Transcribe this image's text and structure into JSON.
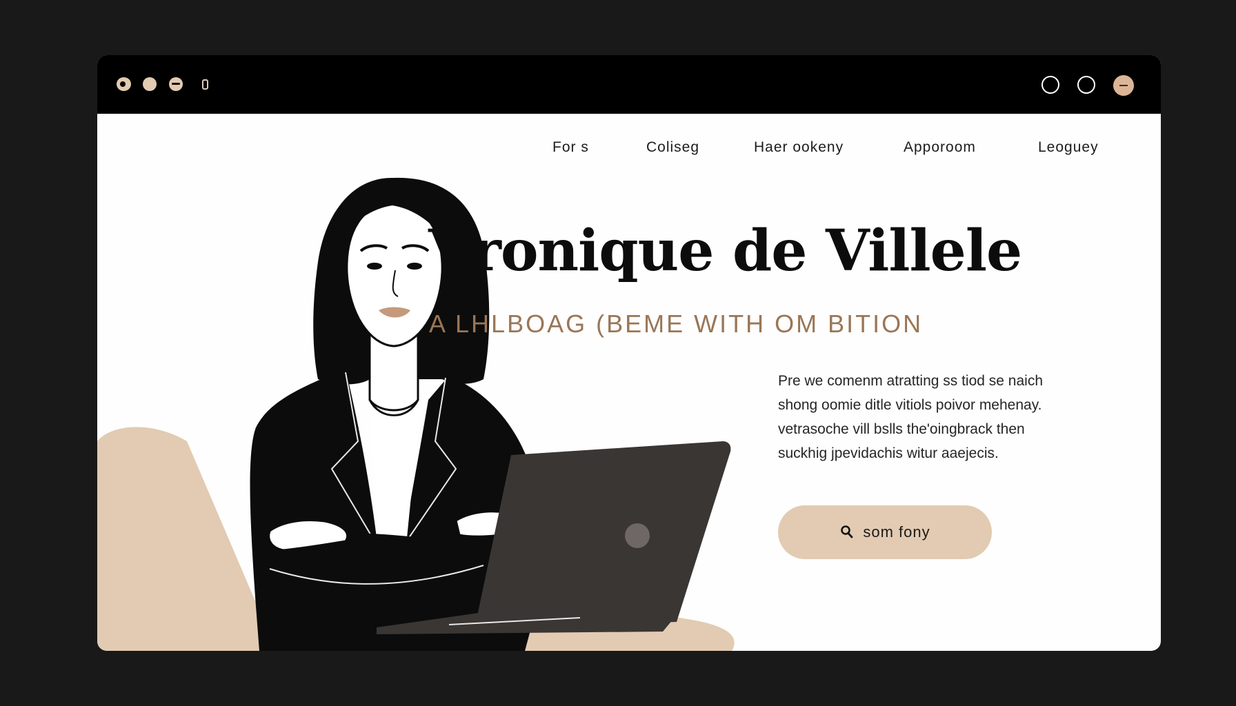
{
  "window": {
    "titlebar": {
      "left_controls": [
        "settings-icon",
        "minimize-dot",
        "toggle-dot",
        "phone-icon"
      ],
      "right_controls": [
        "circle-control",
        "circle-control",
        "user-avatar"
      ]
    }
  },
  "nav": {
    "items": [
      {
        "label": "For s"
      },
      {
        "label": "Coliseg"
      },
      {
        "label": "Haer ookeny"
      },
      {
        "label": "Apporoom"
      },
      {
        "label": "Leoguey"
      }
    ]
  },
  "hero": {
    "title": "Vronique de Villele",
    "subtitle": "A LHLBOAG (BEME WITH OM BITION",
    "description_lines": [
      "Pre we comenm atratting ss tiod se naich",
      "shong oomie ditle vitiols poivor mehenay.",
      "vetrasoche vill bslls the'oingbrack then",
      "suckhig jpevidachis witur aaejecis."
    ],
    "cta": {
      "label": "som fony",
      "icon": "search-icon"
    }
  },
  "colors": {
    "background": "#191919",
    "titlebar": "#000000",
    "page": "#fefefe",
    "accent": "#e2cbb2",
    "subtitle": "#9a7656",
    "laptop": "#3a3634"
  }
}
